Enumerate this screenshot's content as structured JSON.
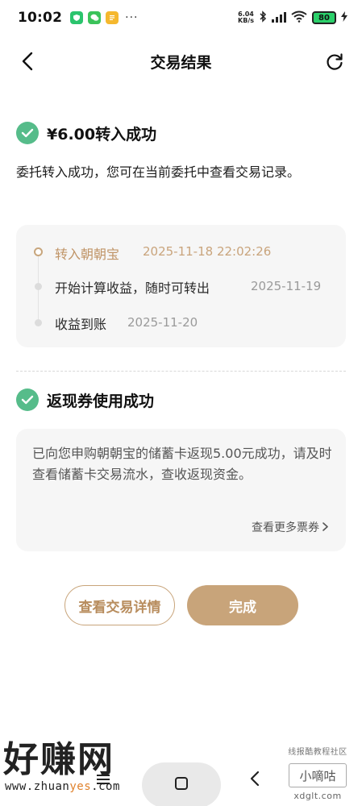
{
  "status_bar": {
    "time": "10:02",
    "more": "···",
    "speed_value": "6.04",
    "speed_unit": "KB/s",
    "battery": "80"
  },
  "header": {
    "title": "交易结果"
  },
  "transfer": {
    "title": "¥6.00转入成功",
    "description": "委托转入成功，您可在当前委托中查看交易记录。",
    "timeline": [
      {
        "label": "转入朝朝宝",
        "date": "2025-11-18 22:02:26"
      },
      {
        "label": "开始计算收益，随时可转出",
        "date": "2025-11-19"
      },
      {
        "label": "收益到账",
        "date": "2025-11-20"
      }
    ]
  },
  "cashback": {
    "title": "返现券使用成功",
    "text": "已向您申购朝朝宝的储蓄卡返现5.00元成功，请及时查看储蓄卡交易流水，查收返现资金。",
    "more_link": "查看更多票券"
  },
  "buttons": {
    "detail": "查看交易详情",
    "done": "完成"
  },
  "watermark_left": {
    "big": "好赚网",
    "small_prefix": "www.zhuan",
    "small_accent": "yes",
    "small_suffix": ".com"
  },
  "watermark_right": {
    "tag": "线报酷教程社区",
    "name": "小嘀咕",
    "site": "xdglt.com"
  },
  "colors": {
    "accent": "#c8a47a",
    "success": "#56bc8a",
    "card_bg": "#f6f6f6"
  }
}
